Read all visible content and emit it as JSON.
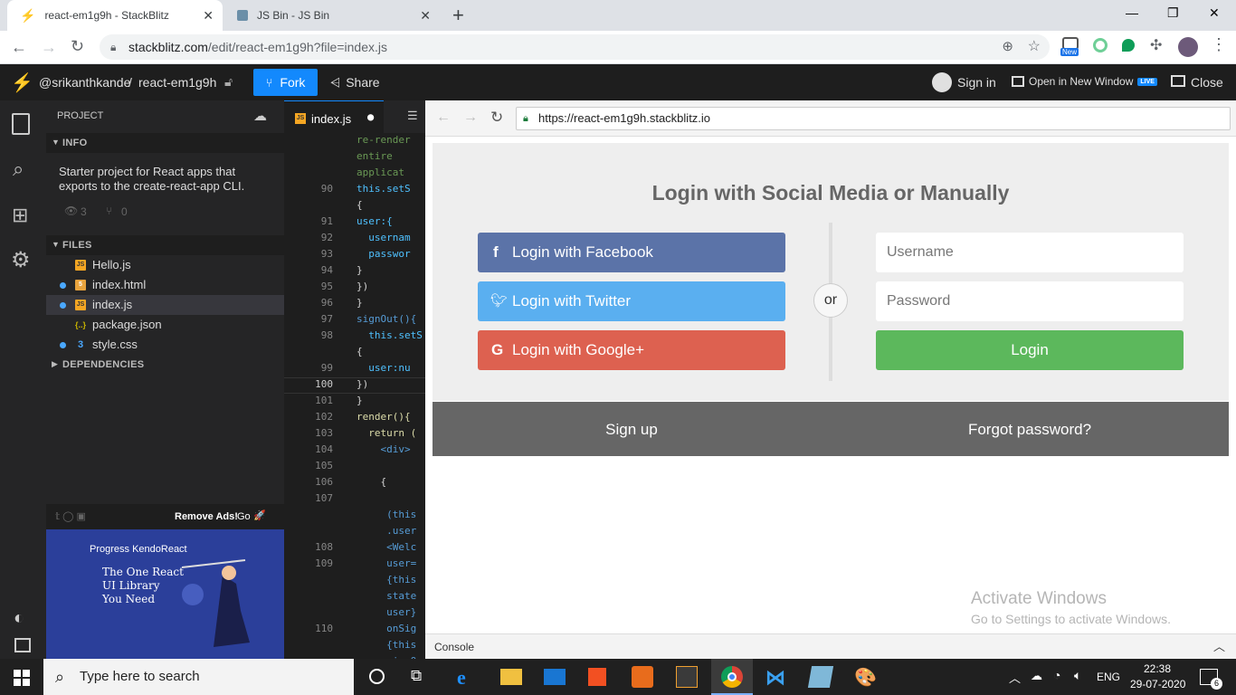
{
  "browser": {
    "tabs": [
      {
        "title": "react-em1g9h - StackBlitz",
        "active": true
      },
      {
        "title": "JS Bin - JS Bin",
        "active": false
      }
    ],
    "new_tab": "+",
    "window_controls": {
      "minimize": "—",
      "maximize": "❐",
      "close": "✕"
    },
    "url_host": "stackblitz.com",
    "url_path": "/edit/react-em1g9h?file=index.js",
    "extension_badge": "New"
  },
  "stackblitz": {
    "user": "@srikanthkande",
    "separator": "/",
    "project": "react-em1g9h",
    "fork_label": "Fork",
    "share_label": "Share",
    "signin_label": "Sign in",
    "open_new_window_label": "Open in New Window",
    "live_badge": "LIVE",
    "close_label": "Close"
  },
  "sidebar": {
    "project_label": "PROJECT",
    "info_label": "INFO",
    "description": "Starter project for React apps that exports to the create-react-app CLI.",
    "views": "3",
    "forks": "0",
    "files_label": "FILES",
    "files": [
      {
        "name": "Hello.js",
        "icon": "JS",
        "modified": false,
        "selected": false
      },
      {
        "name": "index.html",
        "icon": "5",
        "modified": true,
        "selected": false
      },
      {
        "name": "index.js",
        "icon": "JS",
        "modified": true,
        "selected": true
      },
      {
        "name": "package.json",
        "icon": "{..}",
        "modified": false,
        "selected": false
      },
      {
        "name": "style.css",
        "icon": "3",
        "modified": true,
        "selected": false
      }
    ],
    "dependencies_label": "DEPENDENCIES",
    "ad_remove": "Remove Ads!",
    "ad_go": "Go",
    "ad_brand": "Progress KendoReact",
    "ad_text": [
      "The One React",
      "UI Library",
      "You Need"
    ]
  },
  "editor": {
    "tab_label": "index.js",
    "lines": [
      {
        "num": "",
        "code": "re-render"
      },
      {
        "num": "",
        "code": "entire"
      },
      {
        "num": "",
        "code": "applicat"
      },
      {
        "num": "90",
        "code": "this.setS"
      },
      {
        "num": "",
        "code": "{"
      },
      {
        "num": "91",
        "code": "user:{"
      },
      {
        "num": "92",
        "code": "  usernam"
      },
      {
        "num": "93",
        "code": "  passwor"
      },
      {
        "num": "94",
        "code": "}"
      },
      {
        "num": "95",
        "code": "})"
      },
      {
        "num": "96",
        "code": "}"
      },
      {
        "num": "97",
        "code": "signOut(){"
      },
      {
        "num": "98",
        "code": "  this.setS"
      },
      {
        "num": "",
        "code": "{"
      },
      {
        "num": "99",
        "code": "  user:nu"
      },
      {
        "num": "100",
        "code": "})"
      },
      {
        "num": "101",
        "code": "}"
      },
      {
        "num": "102",
        "code": "render(){"
      },
      {
        "num": "103",
        "code": "  return ("
      },
      {
        "num": "104",
        "code": "    <div>"
      },
      {
        "num": "105",
        "code": ""
      },
      {
        "num": "106",
        "code": "    {"
      },
      {
        "num": "107",
        "code": ""
      },
      {
        "num": "",
        "code": "     (this"
      },
      {
        "num": "",
        "code": "     .user"
      },
      {
        "num": "108",
        "code": "     <Welc"
      },
      {
        "num": "109",
        "code": "     user="
      },
      {
        "num": "",
        "code": "     {this"
      },
      {
        "num": "",
        "code": "     state"
      },
      {
        "num": "",
        "code": "     user}"
      },
      {
        "num": "110",
        "code": "     onSig"
      },
      {
        "num": "",
        "code": "     {this"
      },
      {
        "num": "",
        "code": "     signO"
      }
    ]
  },
  "preview": {
    "url": "https://react-em1g9h.stackblitz.io",
    "heading": "Login with Social Media or Manually",
    "facebook_label": "Login with Facebook",
    "twitter_label": "Login with Twitter",
    "google_label": "Login with Google+",
    "or_label": "or",
    "username_placeholder": "Username",
    "password_placeholder": "Password",
    "login_label": "Login",
    "signup_label": "Sign up",
    "forgot_label": "Forgot password?",
    "activate_title": "Activate Windows",
    "activate_sub": "Go to Settings to activate Windows.",
    "console_label": "Console",
    "colors": {
      "facebook": "#5b73a8",
      "twitter": "#5aaff0",
      "google": "#dd6150",
      "login": "#5cb85c"
    }
  },
  "taskbar": {
    "search_placeholder": "Type here to search",
    "lang": "ENG",
    "time": "22:38",
    "date": "29-07-2020",
    "notifications": "6"
  }
}
